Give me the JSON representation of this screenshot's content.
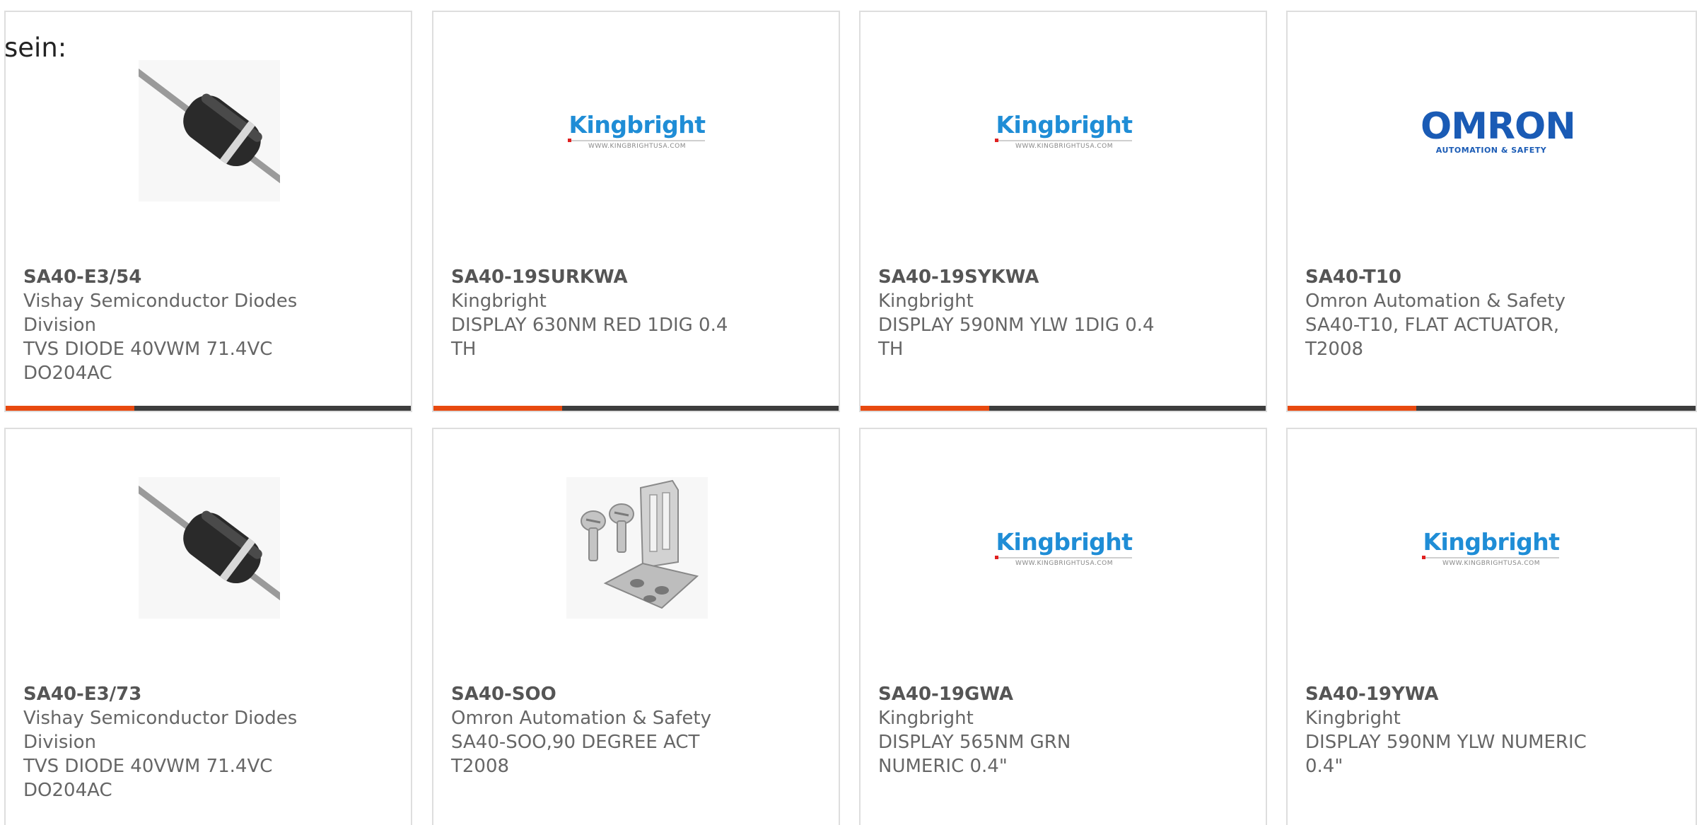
{
  "intro_text": "sein:",
  "kingbright_logo": {
    "name": "Kingbright",
    "url": "WWW.KINGBRIGHTUSA.COM"
  },
  "omron_logo": {
    "name": "OMRON",
    "sub": "AUTOMATION & SAFETY"
  },
  "colors": {
    "accent": "#e8490f",
    "bar": "#3d3d3d",
    "kingbright": "#1f8dd6",
    "omron": "#1a5bb5"
  },
  "products": [
    {
      "part_number": "SA40-E3/54",
      "manufacturer": "Vishay Semiconductor Diodes Division",
      "description": "TVS DIODE 40VWM 71.4VC DO204AC",
      "image": "axial-diode-icon"
    },
    {
      "part_number": "SA40-19SURKWA",
      "manufacturer": "Kingbright",
      "description": "DISPLAY 630NM RED 1DIG 0.4 TH",
      "image": "kingbright-logo"
    },
    {
      "part_number": "SA40-19SYKWA",
      "manufacturer": "Kingbright",
      "description": "DISPLAY 590NM YLW 1DIG 0.4 TH",
      "image": "kingbright-logo"
    },
    {
      "part_number": "SA40-T10",
      "manufacturer": "Omron Automation & Safety",
      "description": "SA40-T10, FLAT ACTUATOR, T2008",
      "image": "omron-logo"
    },
    {
      "part_number": "SA40-E3/73",
      "manufacturer": "Vishay Semiconductor Diodes Division",
      "description": "TVS DIODE 40VWM 71.4VC DO204AC",
      "image": "axial-diode-icon"
    },
    {
      "part_number": "SA40-SOO",
      "manufacturer": "Omron Automation & Safety",
      "description": "SA40-SOO,90 DEGREE ACT T2008",
      "image": "actuator-bracket-icon"
    },
    {
      "part_number": "SA40-19GWA",
      "manufacturer": "Kingbright",
      "description": "DISPLAY 565NM GRN NUMERIC 0.4\"",
      "image": "kingbright-logo"
    },
    {
      "part_number": "SA40-19YWA",
      "manufacturer": "Kingbright",
      "description": "DISPLAY 590NM YLW NUMERIC 0.4\"",
      "image": "kingbright-logo"
    }
  ]
}
